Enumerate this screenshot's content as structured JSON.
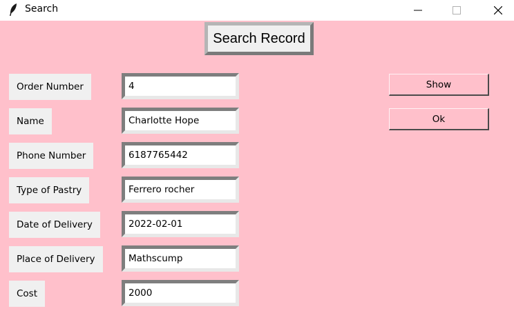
{
  "window": {
    "title": "Search",
    "title_icon": "feather-icon",
    "controls": [
      "minimize-icon",
      "maximize-icon",
      "close-icon"
    ]
  },
  "heading": "Search Record",
  "fields": [
    {
      "label": "Order Number",
      "value": "4"
    },
    {
      "label": "Name",
      "value": "Charlotte Hope"
    },
    {
      "label": "Phone Number",
      "value": "6187765442"
    },
    {
      "label": "Type of Pastry",
      "value": "Ferrero rocher"
    },
    {
      "label": "Date of Delivery",
      "value": "2022-02-01"
    },
    {
      "label": "Place of Delivery",
      "value": "Mathscump"
    },
    {
      "label": "Cost",
      "value": "2000"
    }
  ],
  "buttons": {
    "show": "Show",
    "ok": "Ok"
  },
  "colors": {
    "background": "#ffc0cb",
    "label_background": "#f0f0f0",
    "entry_background": "#ffffff"
  }
}
